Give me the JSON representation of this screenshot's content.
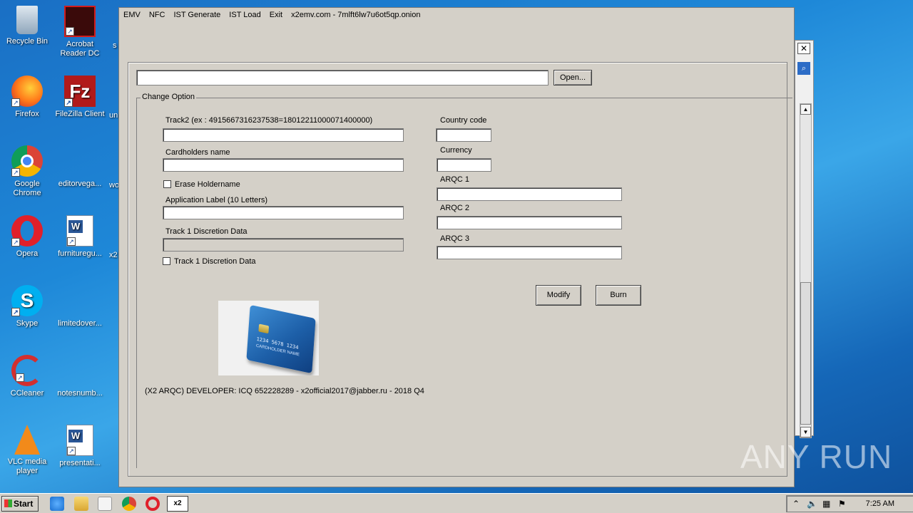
{
  "desktop": {
    "icons": [
      {
        "label": "Recycle Bin"
      },
      {
        "label": "Acrobat Reader DC"
      },
      {
        "label": "Firefox"
      },
      {
        "label": "FileZilla Client"
      },
      {
        "label": "Google Chrome"
      },
      {
        "label": "editorvega..."
      },
      {
        "label": "Opera"
      },
      {
        "label": "furnituregu..."
      },
      {
        "label": "Skype"
      },
      {
        "label": "limitedover..."
      },
      {
        "label": "CCleaner"
      },
      {
        "label": "notesnumb..."
      },
      {
        "label": "VLC media player"
      },
      {
        "label": "presentati..."
      }
    ],
    "partial_labels": [
      "s",
      "un",
      "wo",
      "x2"
    ]
  },
  "app": {
    "menu": [
      "EMV",
      "NFC",
      "IST Generate",
      "IST Load",
      "Exit"
    ],
    "title": "x2emv.com - 7mlft6lw7u6ot5qp.onion",
    "file_path": "",
    "open_button": "Open...",
    "group_title": "Change Option",
    "fields": {
      "track2_label": "Track2 (ex : 4915667316237538=18012211000071400000)",
      "track2_value": "",
      "cardholder_label": "Cardholders name",
      "cardholder_value": "",
      "erase_holdername_label": "Erase Holdername",
      "erase_holdername_checked": false,
      "app_label_label": "Application Label (10 Letters)",
      "app_label_value": "",
      "track1_disc_label": "Track 1 Discretion Data",
      "track1_disc_value": "",
      "track1_disc_check_label": "Track 1 Discretion Data",
      "track1_disc_checked": false,
      "country_label": "Country code",
      "country_value": "",
      "currency_label": "Currency",
      "currency_value": "",
      "arqc1_label": "ARQC 1",
      "arqc1_value": "",
      "arqc2_label": "ARQC 2",
      "arqc2_value": "",
      "arqc3_label": "ARQC 3",
      "arqc3_value": ""
    },
    "modify_button": "Modify",
    "burn_button": "Burn",
    "card": {
      "number": "1234 5678 1234",
      "holder": "CARDHOLDER NAME"
    },
    "footer": "(X2 ARQC) DEVELOPER: ICQ 652228289 - x2official2017@jabber.ru - 2018 Q4"
  },
  "taskbar": {
    "start_label": "Start",
    "active_task": "x2",
    "clock": "7:25 AM"
  },
  "watermark": "ANY RUN"
}
